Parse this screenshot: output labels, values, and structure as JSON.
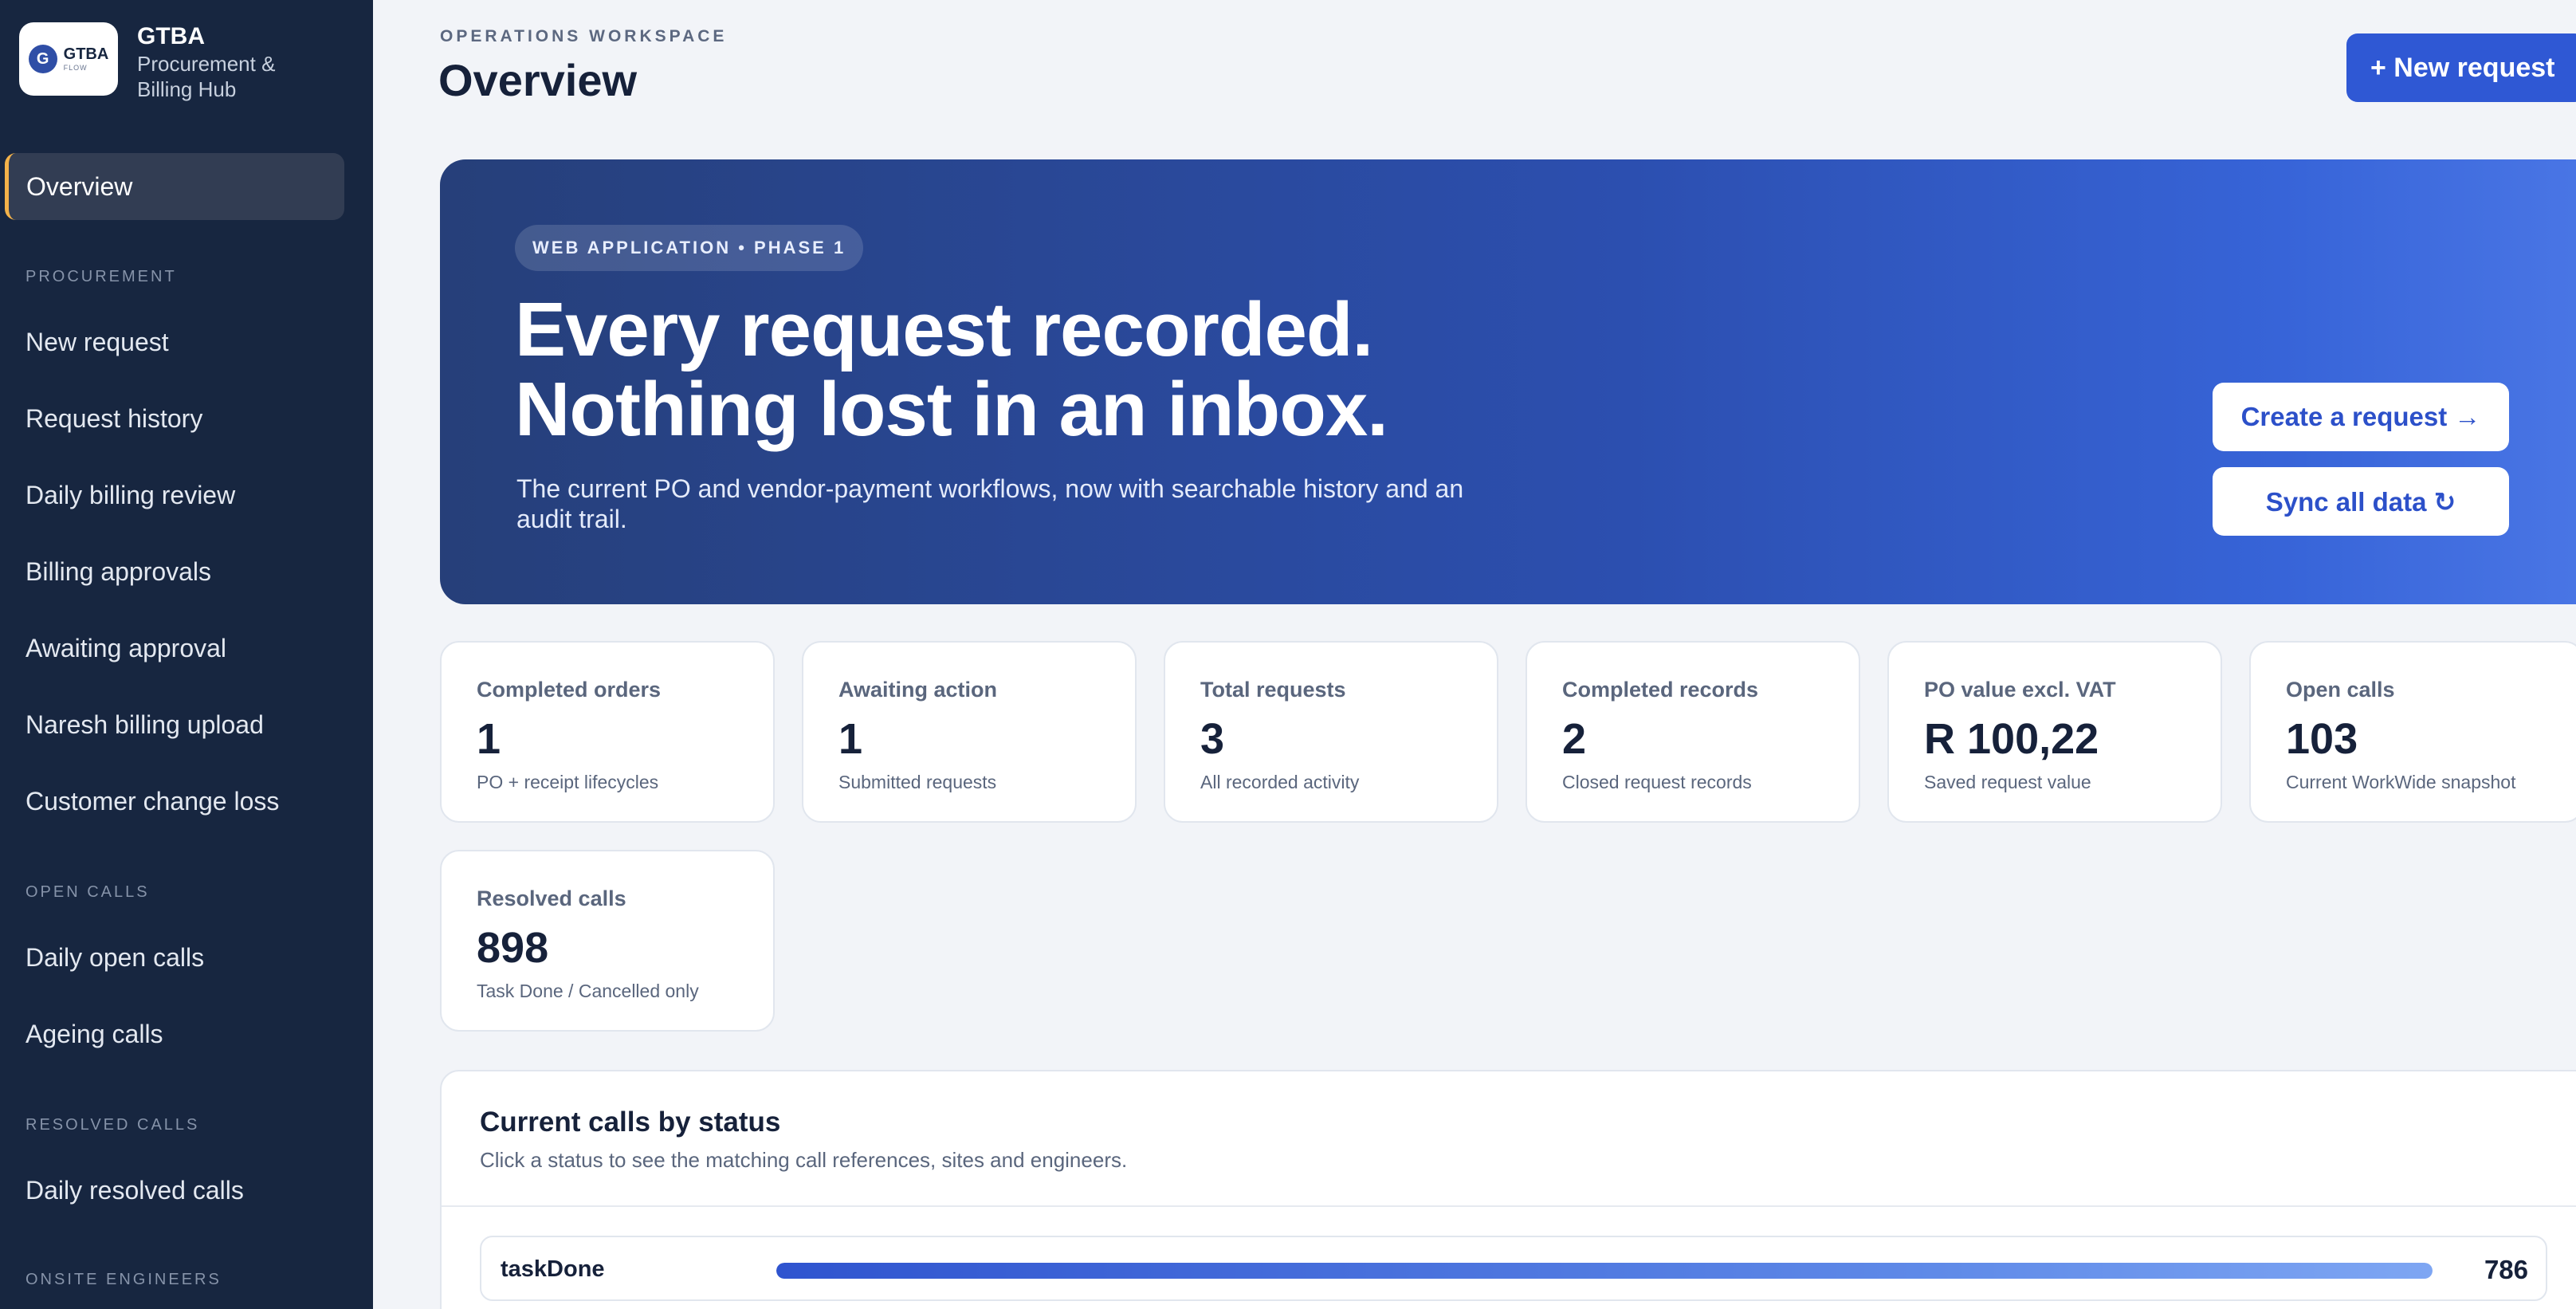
{
  "brand": {
    "logo_text": "GTBA",
    "logo_sub": "FLOW",
    "name": "GTBA",
    "subtitle": "Procurement & Billing Hub"
  },
  "sidebar": {
    "active": "Overview",
    "sections": {
      "procurement": "PROCUREMENT",
      "open_calls": "OPEN CALLS",
      "resolved_calls": "RESOLVED CALLS",
      "onsite_engineers": "ONSITE ENGINEERS"
    },
    "procurement_items": [
      "New request",
      "Request history",
      "Daily billing review",
      "Billing approvals",
      "Awaiting approval",
      "Naresh billing upload",
      "Customer change loss"
    ],
    "open_calls_items": [
      "Daily open calls",
      "Ageing calls"
    ],
    "resolved_calls_items": [
      "Daily resolved calls"
    ]
  },
  "header": {
    "eyebrow": "OPERATIONS WORKSPACE",
    "title": "Overview",
    "new_request_label": "+ New request"
  },
  "hero": {
    "pill": "WEB APPLICATION • PHASE 1",
    "headline_line1": "Every request recorded.",
    "headline_line2": "Nothing lost in an inbox.",
    "description": "The current PO and vendor-payment workflows, now with searchable history and an audit trail.",
    "create_button": "Create a request →",
    "sync_button": "Sync all data ↻"
  },
  "stats": [
    {
      "label": "Completed orders",
      "value": "1",
      "sub": "PO + receipt lifecycles"
    },
    {
      "label": "Awaiting action",
      "value": "1",
      "sub": "Submitted requests"
    },
    {
      "label": "Total requests",
      "value": "3",
      "sub": "All recorded activity"
    },
    {
      "label": "Completed records",
      "value": "2",
      "sub": "Closed request records"
    },
    {
      "label": "PO value excl. VAT",
      "value": "R 100,22",
      "sub": "Saved request value"
    },
    {
      "label": "Open calls",
      "value": "103",
      "sub": "Current WorkWide snapshot"
    },
    {
      "label": "Resolved calls",
      "value": "898",
      "sub": "Task Done / Cancelled only"
    }
  ],
  "calls_panel": {
    "title": "Current calls by status",
    "subtitle": "Click a status to see the matching call references, sites and engineers.",
    "rows": [
      {
        "status": "taskDone",
        "count": "786",
        "fill_fraction": 1.0
      }
    ]
  },
  "colors": {
    "sidebar_bg": "#172640",
    "accent": "#2f58d4",
    "active_marker": "#f3b24a"
  }
}
